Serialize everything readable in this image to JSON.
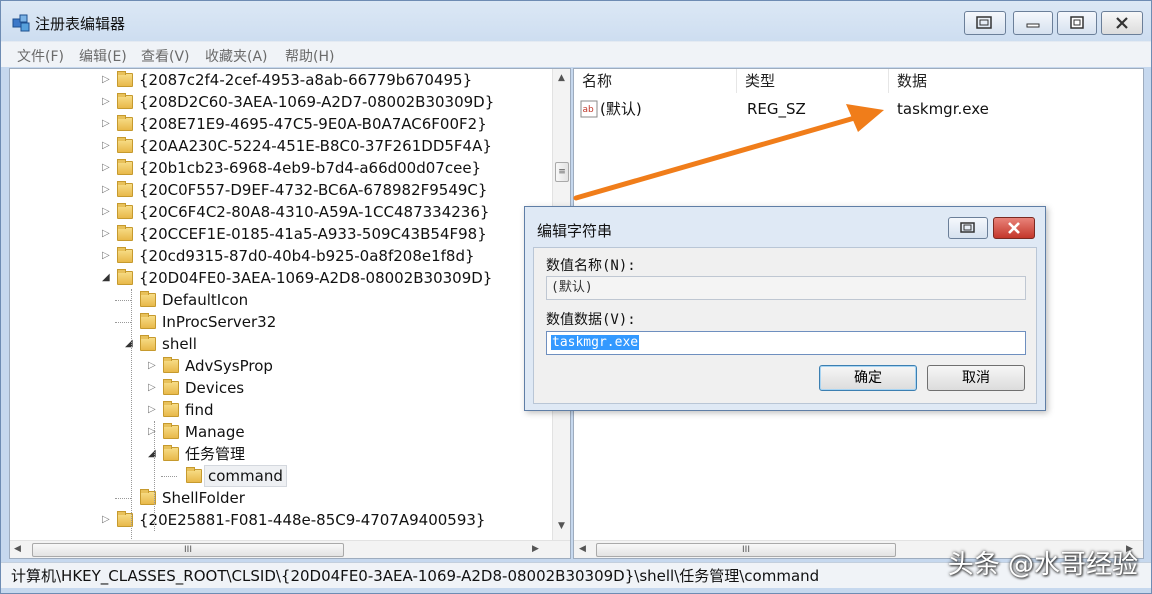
{
  "window": {
    "title": "注册表编辑器",
    "menu": [
      "文件(F)",
      "编辑(E)",
      "查看(V)",
      "收藏夹(A)",
      "帮助(H)"
    ]
  },
  "tree": {
    "items": [
      {
        "label": "{2087c2f4-2cef-4953-a8ab-66779b670495}",
        "level": 0,
        "expander": "collapsed"
      },
      {
        "label": "{208D2C60-3AEA-1069-A2D7-08002B30309D}",
        "level": 0,
        "expander": "collapsed"
      },
      {
        "label": "{208E71E9-4695-47C5-9E0A-B0A7AC6F00F2}",
        "level": 0,
        "expander": "collapsed"
      },
      {
        "label": "{20AA230C-5224-451E-B8C0-37F261DD5F4A}",
        "level": 0,
        "expander": "collapsed"
      },
      {
        "label": "{20b1cb23-6968-4eb9-b7d4-a66d00d07cee}",
        "level": 0,
        "expander": "collapsed"
      },
      {
        "label": "{20C0F557-D9EF-4732-BC6A-678982F9549C}",
        "level": 0,
        "expander": "collapsed"
      },
      {
        "label": "{20C6F4C2-80A8-4310-A59A-1CC487334236}",
        "level": 0,
        "expander": "collapsed"
      },
      {
        "label": "{20CCEF1E-0185-41a5-A933-509C43B54F98}",
        "level": 0,
        "expander": "collapsed"
      },
      {
        "label": "{20cd9315-87d0-40b4-b925-0a8f208e1f8d}",
        "level": 0,
        "expander": "collapsed"
      },
      {
        "label": "{20D04FE0-3AEA-1069-A2D8-08002B30309D}",
        "level": 0,
        "expander": "expanded"
      },
      {
        "label": "DefaultIcon",
        "level": 1,
        "expander": "none"
      },
      {
        "label": "InProcServer32",
        "level": 1,
        "expander": "none"
      },
      {
        "label": "shell",
        "level": 1,
        "expander": "expanded"
      },
      {
        "label": "AdvSysProp",
        "level": 2,
        "expander": "collapsed"
      },
      {
        "label": "Devices",
        "level": 2,
        "expander": "collapsed"
      },
      {
        "label": "find",
        "level": 2,
        "expander": "collapsed"
      },
      {
        "label": "Manage",
        "level": 2,
        "expander": "collapsed"
      },
      {
        "label": "任务管理",
        "level": 2,
        "expander": "expanded"
      },
      {
        "label": "command",
        "level": 3,
        "expander": "none",
        "selected": true
      },
      {
        "label": "ShellFolder",
        "level": 1,
        "expander": "none"
      },
      {
        "label": "{20E25881-F081-448e-85C9-4707A9400593}",
        "level": 0,
        "expander": "collapsed"
      }
    ]
  },
  "list": {
    "columns": [
      "名称",
      "类型",
      "数据"
    ],
    "rows": [
      {
        "name": "(默认)",
        "type": "REG_SZ",
        "data": "taskmgr.exe"
      }
    ]
  },
  "scroll": {
    "h_thumb": "III",
    "v_thumb": "≡"
  },
  "statusbar": {
    "path": "计算机\\HKEY_CLASSES_ROOT\\CLSID\\{20D04FE0-3AEA-1069-A2D8-08002B30309D}\\shell\\任务管理\\command"
  },
  "dialog": {
    "title": "编辑字符串",
    "name_label": "数值名称(N):",
    "name_value": "(默认)",
    "data_label": "数值数据(V):",
    "data_value": "taskmgr.exe",
    "ok": "确定",
    "cancel": "取消"
  },
  "watermark": "头条 @水哥经验",
  "colors": {
    "annotation_arrow": "#f07d1a",
    "selection": "#3399ff"
  }
}
